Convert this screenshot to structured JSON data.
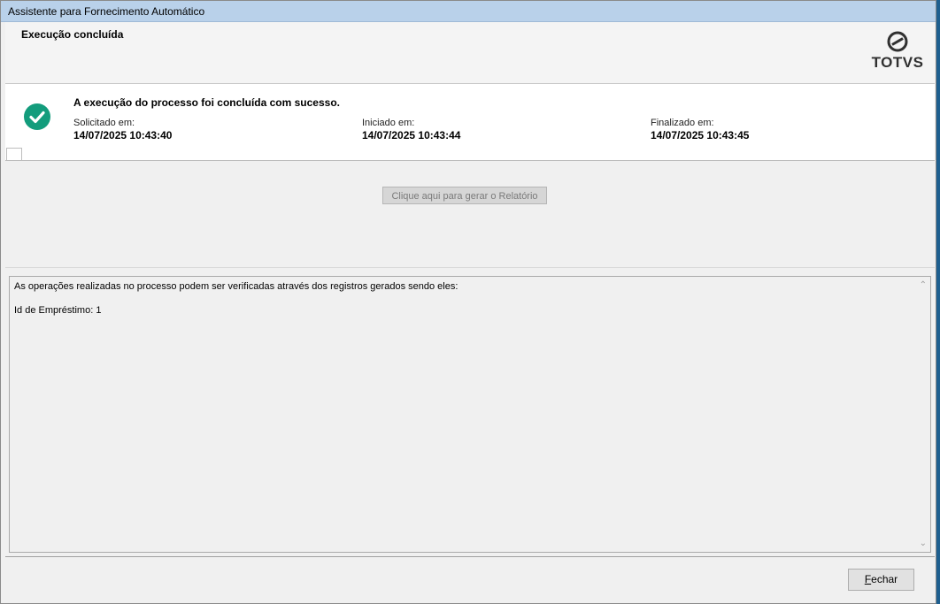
{
  "window": {
    "title": "Assistente para Fornecimento Automático"
  },
  "header": {
    "step_title": "Execução concluída",
    "logo_text": "TOTVS"
  },
  "status": {
    "icon": "success-check-icon",
    "message": "A execução do processo foi concluída com sucesso.",
    "requested_label": "Solicitado em:",
    "requested_value": "14/07/2025 10:43:40",
    "started_label": "Iniciado em:",
    "started_value": "14/07/2025 10:43:44",
    "finished_label": "Finalizado em:",
    "finished_value": "14/07/2025 10:43:45"
  },
  "panel": {
    "report_button_label": "Clique aqui para gerar o Relatório",
    "log_line_1": "As operações realizadas no processo podem ser verificadas através dos registros gerados sendo eles:",
    "log_line_2": "Id de Empréstimo: 1"
  },
  "footer": {
    "close_button_first": "F",
    "close_button_rest": "echar"
  },
  "colors": {
    "success": "#139c7c",
    "titlebar": "#b9d1ea"
  }
}
